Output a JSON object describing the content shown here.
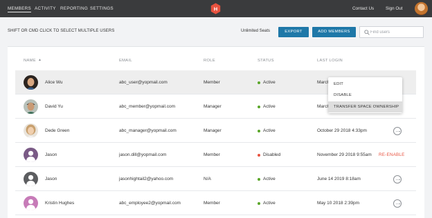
{
  "nav": {
    "members": "MEMBERS",
    "activity": "ACTIVITY",
    "reporting": "REPORTING",
    "settings": "SETTINGS",
    "logo_letter": "H",
    "contact_us": "Contact Us",
    "sign_out": "Sign Out"
  },
  "toolbar": {
    "hint": "SHIFT OR CMD CLICK TO SELECT MULTIPLE USERS",
    "seats": "Unlimited Seats",
    "export_label": "EXPORT",
    "add_members_label": "ADD MEMBERS",
    "search_placeholder": "Find users"
  },
  "table": {
    "columns": {
      "name": "NAME",
      "email": "EMAIL",
      "role": "ROLE",
      "status": "STATUS",
      "last_login": "LAST LOGIN"
    },
    "rows": [
      {
        "name": "Alice Wu",
        "email": "abc_user@yopmail.com",
        "role": "Member",
        "status": "Active",
        "last_login": "March"
      },
      {
        "name": "David Yu",
        "email": "abc_member@yopmail.com",
        "role": "Manager",
        "status": "Active",
        "last_login": "March"
      },
      {
        "name": "Dede Green",
        "email": "abc_manager@yopmail.com",
        "role": "Manager",
        "status": "Active",
        "last_login": "October 29 2018 4:33pm"
      },
      {
        "name": "Jason",
        "email": "jason.dill@yopmail.com",
        "role": "Member",
        "status": "Disabled",
        "last_login": "November 29 2018 9:55am",
        "action": "RE-ENABLE"
      },
      {
        "name": "Jason",
        "email": "jasonhightail2@yahoo.com",
        "role": "N/A",
        "status": "Active",
        "last_login": "June 14 2019 8:18am"
      },
      {
        "name": "Kristin Hughes",
        "email": "abc_employee2@yopmail.com",
        "role": "Member",
        "status": "Active",
        "last_login": "May 10 2018 2:39pm"
      }
    ]
  },
  "row_menu": {
    "edit": "EDIT",
    "disable": "DISABLE",
    "transfer": "TRANSFER SPACE OWNERSHIP"
  },
  "colors": {
    "topbar": "#3a3b3d",
    "accent": "#1f78a8",
    "logo": "#e8523f",
    "active": "#5aa629",
    "disabled": "#e8523f"
  },
  "icons": {
    "logo": "hightail-logo-icon",
    "search": "search-icon",
    "sort": "sort-up-icon",
    "more": "more-options-icon"
  }
}
